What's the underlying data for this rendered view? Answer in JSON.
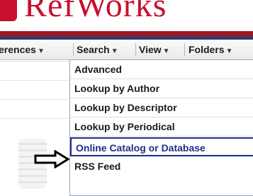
{
  "logo": {
    "text": "RefWorks"
  },
  "menu": {
    "items": [
      {
        "label": "erences"
      },
      {
        "label": "Search"
      },
      {
        "label": "View"
      },
      {
        "label": "Folders"
      }
    ]
  },
  "dropdown": {
    "items": [
      {
        "label": "Advanced"
      },
      {
        "label": "Lookup by Author"
      },
      {
        "label": "Lookup by Descriptor"
      },
      {
        "label": "Lookup by Periodical"
      },
      {
        "label": "Online Catalog or Database"
      },
      {
        "label": "RSS Feed"
      }
    ],
    "highlighted_index": 4
  },
  "colors": {
    "brand_red": "#c8102e",
    "rule_red": "#9b1b24",
    "rule_blue": "#243c78",
    "highlight_border": "#1d2e8a"
  },
  "icons": {
    "pointer": "arrow-right-icon",
    "caret": "caret-down-icon"
  }
}
